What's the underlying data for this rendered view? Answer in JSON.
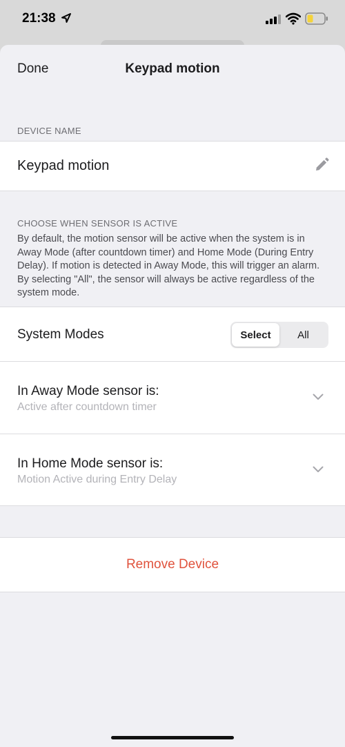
{
  "status_bar": {
    "time": "21:38"
  },
  "nav": {
    "done_label": "Done",
    "title": "Keypad motion"
  },
  "device_name": {
    "header": "DEVICE NAME",
    "value": "Keypad motion"
  },
  "sensor": {
    "header": "CHOOSE WHEN SENSOR IS ACTIVE",
    "description": "By default, the motion sensor will be active when the system is in Away Mode (after countdown timer) and  Home Mode (During Entry Delay). If motion is detected in Away Mode, this will trigger an alarm. By selecting \"All\", the sensor will always be active regardless of the system mode."
  },
  "system_modes": {
    "label": "System Modes",
    "options": [
      "Select",
      "All"
    ],
    "selected": "Select"
  },
  "away_mode": {
    "title": "In Away Mode sensor is:",
    "value": "Active after countdown timer"
  },
  "home_mode": {
    "title": "In Home Mode sensor is:",
    "value": "Motion Active during Entry Delay"
  },
  "remove_label": "Remove Device",
  "colors": {
    "accent_destructive": "#e0533d",
    "background": "#f0f0f4"
  }
}
